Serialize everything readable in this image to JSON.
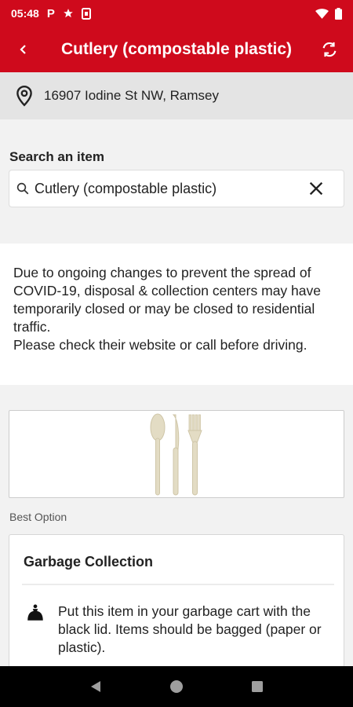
{
  "status_bar": {
    "time": "05:48",
    "notification_icons": [
      "parking-icon",
      "star-icon",
      "sim-card-icon"
    ],
    "system_icons": [
      "wifi-icon",
      "battery-icon"
    ]
  },
  "app_bar": {
    "title": "Cutlery (compostable plastic)",
    "color": "#cf0a1c"
  },
  "location": {
    "address": "16907 Iodine St NW, Ramsey"
  },
  "search": {
    "label": "Search an item",
    "value": "Cutlery (compostable plastic)"
  },
  "notice": {
    "line1": "Due to ongoing changes to prevent the spread of COVID-19, disposal & collection centers may have temporarily closed or may be closed to residential traffic.",
    "line2": "Please check their website or call before driving."
  },
  "item_image": {
    "description_icon": "cutlery-icon"
  },
  "best_option": {
    "label": "Best Option",
    "title": "Garbage Collection",
    "icon": "garbage-bag-icon",
    "instruction": "Put this item in your garbage cart with the black lid. Items should be bagged (paper or plastic)."
  },
  "nav_bar": {
    "buttons": [
      "back-nav-icon",
      "home-nav-icon",
      "recents-nav-icon"
    ]
  }
}
